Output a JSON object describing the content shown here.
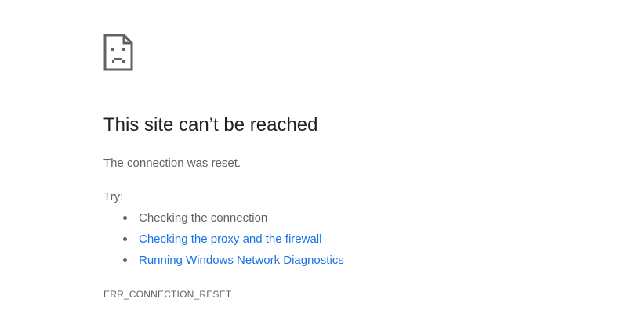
{
  "error": {
    "icon": "sad-page-icon",
    "title": "This site can’t be reached",
    "summary": "The connection was reset.",
    "try_label": "Try:",
    "suggestions": [
      {
        "text": "Checking the connection",
        "is_link": false
      },
      {
        "text": "Checking the proxy and the firewall",
        "is_link": true
      },
      {
        "text": "Running Windows Network Diagnostics",
        "is_link": true
      }
    ],
    "code": "ERR_CONNECTION_RESET"
  },
  "colors": {
    "title": "#202124",
    "body_text": "#5f6368",
    "link": "#1a73e8",
    "icon": "#5f6368"
  }
}
